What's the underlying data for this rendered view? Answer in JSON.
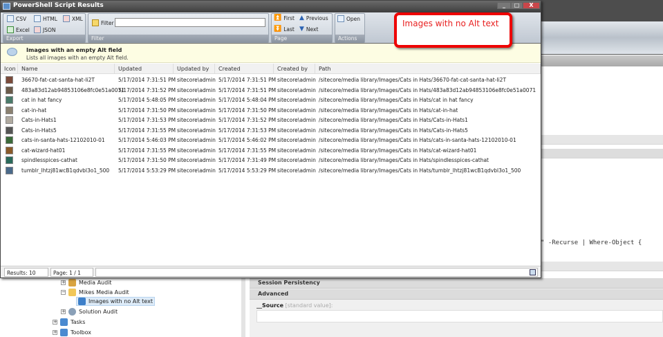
{
  "window": {
    "title": "PowerShell Script Results",
    "minimize": "_",
    "maximize": "□",
    "close": "X"
  },
  "ribbon": {
    "export": {
      "label": "Export",
      "buttons": [
        "CSV",
        "HTML",
        "XML",
        "Excel",
        "JSON"
      ]
    },
    "filter": {
      "label": "Filter",
      "button": "Filter",
      "value": ""
    },
    "page": {
      "label": "Page",
      "first": "First",
      "previous": "Previous",
      "last": "Last",
      "next": "Next"
    },
    "actions": {
      "label": "Actions",
      "open": "Open"
    }
  },
  "banner": {
    "title": "Images with an empty Alt field",
    "description": "Lists all images with an empty Alt field."
  },
  "table": {
    "columns": [
      "Icon",
      "Name",
      "Updated",
      "Updated by",
      "Created",
      "Created by",
      "Path"
    ],
    "rows": [
      {
        "name": "36670-fat-cat-santa-hat-Ii2T",
        "updated": "5/17/2014 7:31:51 PM",
        "updated_by": "sitecore\\admin",
        "created": "5/17/2014 7:31:51 PM",
        "created_by": "sitecore\\admin",
        "path": "/sitecore/media library/Images/Cats in Hats/36670-fat-cat-santa-hat-Ii2T",
        "color": "#7a4a3a"
      },
      {
        "name": "483a83d12ab94853106e8fc0e51a0071",
        "updated": "5/17/2014 7:31:52 PM",
        "updated_by": "sitecore\\admin",
        "created": "5/17/2014 7:31:51 PM",
        "created_by": "sitecore\\admin",
        "path": "/sitecore/media library/Images/Cats in Hats/483a83d12ab94853106e8fc0e51a0071",
        "color": "#6b5a4a"
      },
      {
        "name": "cat in hat fancy",
        "updated": "5/17/2014 5:48:05 PM",
        "updated_by": "sitecore\\admin",
        "created": "5/17/2014 5:48:04 PM",
        "created_by": "sitecore\\admin",
        "path": "/sitecore/media library/Images/Cats in Hats/cat in hat fancy",
        "color": "#4a7a6a"
      },
      {
        "name": "cat-in-hat",
        "updated": "5/17/2014 7:31:50 PM",
        "updated_by": "sitecore\\admin",
        "created": "5/17/2014 7:31:50 PM",
        "created_by": "sitecore\\admin",
        "path": "/sitecore/media library/Images/Cats in Hats/cat-in-hat",
        "color": "#8a8070"
      },
      {
        "name": "Cats-in-Hats1",
        "updated": "5/17/2014 7:31:53 PM",
        "updated_by": "sitecore\\admin",
        "created": "5/17/2014 7:31:52 PM",
        "created_by": "sitecore\\admin",
        "path": "/sitecore/media library/Images/Cats in Hats/Cats-in-Hats1",
        "color": "#b0aaa0"
      },
      {
        "name": "Cats-in-Hats5",
        "updated": "5/17/2014 7:31:55 PM",
        "updated_by": "sitecore\\admin",
        "created": "5/17/2014 7:31:53 PM",
        "created_by": "sitecore\\admin",
        "path": "/sitecore/media library/Images/Cats in Hats/Cats-in-Hats5",
        "color": "#555"
      },
      {
        "name": "cats-in-santa-hats-12102010-01",
        "updated": "5/17/2014 5:46:03 PM",
        "updated_by": "sitecore\\admin",
        "created": "5/17/2014 5:46:02 PM",
        "created_by": "sitecore\\admin",
        "path": "/sitecore/media library/Images/Cats in Hats/cats-in-santa-hats-12102010-01",
        "color": "#3a6a3a"
      },
      {
        "name": "cat-wizard-hat01",
        "updated": "5/17/2014 7:31:55 PM",
        "updated_by": "sitecore\\admin",
        "created": "5/17/2014 7:31:55 PM",
        "created_by": "sitecore\\admin",
        "path": "/sitecore/media library/Images/Cats in Hats/cat-wizard-hat01",
        "color": "#8a5a2a"
      },
      {
        "name": "spindlesspices-cathat",
        "updated": "5/17/2014 7:31:50 PM",
        "updated_by": "sitecore\\admin",
        "created": "5/17/2014 7:31:49 PM",
        "created_by": "sitecore\\admin",
        "path": "/sitecore/media library/Images/Cats in Hats/spindlesspices-cathat",
        "color": "#2a6a5a"
      },
      {
        "name": "tumblr_lhtzj81wcB1qdvbl3o1_500",
        "updated": "5/17/2014 5:53:29 PM",
        "updated_by": "sitecore\\admin",
        "created": "5/17/2014 5:53:29 PM",
        "created_by": "sitecore\\admin",
        "path": "/sitecore/media library/Images/Cats in Hats/tumblr_lhtzj81wcB1qdvbl3o1_500",
        "color": "#4a6a8a"
      }
    ]
  },
  "status": {
    "results": "Results: 10",
    "page": "Page: 1 / 1"
  },
  "callout": {
    "text": "Images with no Alt text",
    "color": "#e00000"
  },
  "background": {
    "code": "\" -Recurse | Where-Object {",
    "tree": [
      "Media Audit",
      "Mikes Media Audit",
      "Images with no Alt text",
      "Solution Audit",
      "Tasks",
      "Toolbox"
    ],
    "sections": [
      "Session Persistency",
      "Advanced"
    ],
    "source_label": "__Source",
    "source_hint": "[standard value]:"
  }
}
